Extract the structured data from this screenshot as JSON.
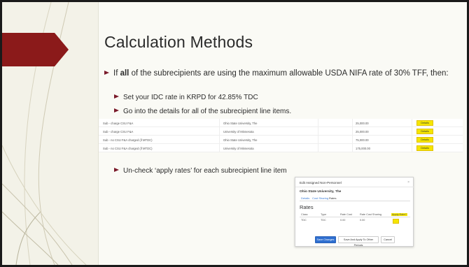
{
  "slide": {
    "title": "Calculation Methods",
    "bullet1": {
      "prefix": "If ",
      "bold": "all",
      "rest": " of the subrecipients are using the maximum allowable USDA NIFA rate of 30% TFF, then:"
    },
    "sub1": "Set your IDC rate in KRPD for 42.85% TDC",
    "sub2": "Go into the details for all of the subrecipient line items.",
    "sub3": "Un-check ‘apply rates’ for each subrecipient line item"
  },
  "table": {
    "rows": [
      {
        "desc": "Sub - charge CSU F&A",
        "org": "Ohio State University, The",
        "amount": "25,000.00",
        "action": "Details"
      },
      {
        "desc": "Sub - charge CSU F&A",
        "org": "University of Minnesota",
        "amount": "25,000.00",
        "action": "Details"
      },
      {
        "desc": "Sub - no CSU F&A charged (if MTDC)",
        "org": "Ohio State University, The",
        "amount": "75,000.00",
        "action": "Details"
      },
      {
        "desc": "Sub - no CSU F&A charged (if MTDC)",
        "org": "University of Minnesota",
        "amount": "175,000.00",
        "action": "Details"
      }
    ]
  },
  "dialog": {
    "title": "Edit Assigned Non-Personnel",
    "close": "×",
    "org": "Ohio State University, The",
    "tabs": [
      "Details",
      "Cost Sharing",
      "Rates"
    ],
    "section": "Rates",
    "columns": [
      "Class",
      "Type",
      "Rate Cost",
      "Rate Cost Sharing",
      "Apply Rate?"
    ],
    "row": [
      "TDC",
      "TDC",
      "0.00",
      "0.00"
    ],
    "buttons": {
      "save": "Save Changes",
      "save_apply": "Save And Apply To Other Periods",
      "cancel": "Cancel"
    }
  },
  "colors": {
    "bullet": "#7a1a2a",
    "arrow": "#8b1a1a",
    "highlight": "#f5e600",
    "primary": "#2f6fd0"
  }
}
